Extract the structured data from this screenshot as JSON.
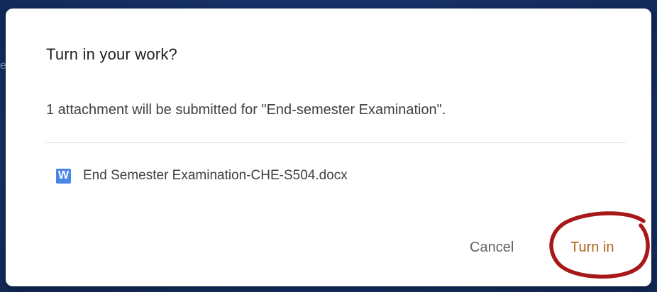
{
  "dialog": {
    "title": "Turn in your work?",
    "message": "1 attachment will be submitted for \"End-semester Examination\".",
    "attachment": {
      "icon": "word-doc-icon",
      "icon_letter": "W",
      "icon_color": "#4a86e8",
      "name": "End Semester Examination-CHE-S504.docx"
    },
    "buttons": {
      "cancel_label": "Cancel",
      "turn_in_label": "Turn in"
    },
    "accent_color": "#b06416"
  },
  "annotation": {
    "type": "hand-drawn ellipse",
    "color": "#a81818",
    "target": "turn-in-button"
  },
  "background": {
    "partial_text": "e"
  }
}
